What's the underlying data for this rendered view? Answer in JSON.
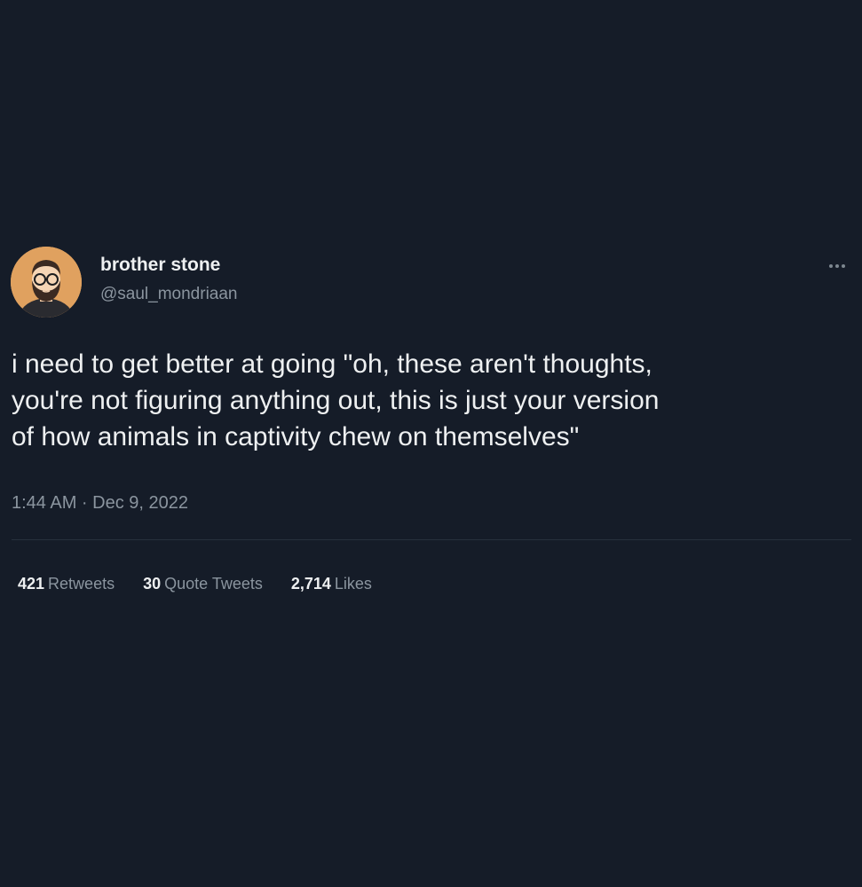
{
  "user": {
    "display_name": "brother stone",
    "handle": "@saul_mondriaan",
    "avatar_icon": "bearded-man-with-glasses-avatar"
  },
  "more_icon": "ellipsis-icon",
  "tweet": {
    "text": "i need to get better at going \"oh, these aren't thoughts,\nyou're not figuring anything out, this is just your version\nof how animals in captivity chew on themselves\"",
    "timestamp": "1:44 AM · Dec 9, 2022"
  },
  "stats": {
    "retweets": {
      "count": "421",
      "label": "Retweets"
    },
    "quotes": {
      "count": "30",
      "label": "Quote Tweets"
    },
    "likes": {
      "count": "2,714",
      "label": "Likes"
    }
  },
  "colors": {
    "background": "#151c28",
    "text": "#eef0f1",
    "secondary": "#8b959f",
    "avatar_bg": "#e0a15f"
  }
}
